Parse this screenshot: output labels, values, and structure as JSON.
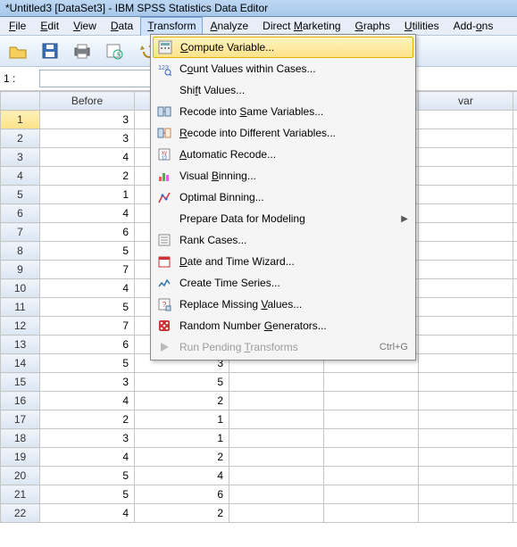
{
  "title": "*Untitled3 [DataSet3] - IBM SPSS Statistics Data Editor",
  "menubar": [
    {
      "label": "File",
      "ul": "F"
    },
    {
      "label": "Edit",
      "ul": "E"
    },
    {
      "label": "View",
      "ul": "V"
    },
    {
      "label": "Data",
      "ul": "D"
    },
    {
      "label": "Transform",
      "ul": "T",
      "open": true
    },
    {
      "label": "Analyze",
      "ul": "A"
    },
    {
      "label": "Direct Marketing",
      "ul": "M"
    },
    {
      "label": "Graphs",
      "ul": "G"
    },
    {
      "label": "Utilities",
      "ul": "U"
    },
    {
      "label": "Add-ons",
      "ul": "o"
    }
  ],
  "transform_menu": [
    {
      "label": "Compute Variable...",
      "ul": "C",
      "icon": "compute",
      "highlight": true
    },
    {
      "label": "Count Values within Cases...",
      "ul": "o",
      "icon": "count"
    },
    {
      "label": "Shift Values...",
      "ul": "f",
      "icon": ""
    },
    {
      "label": "Recode into Same Variables...",
      "ul": "S",
      "icon": "recode-same"
    },
    {
      "label": "Recode into Different Variables...",
      "ul": "R",
      "icon": "recode-diff"
    },
    {
      "label": "Automatic Recode...",
      "ul": "A",
      "icon": "auto-recode"
    },
    {
      "label": "Visual Binning...",
      "ul": "B",
      "icon": "visual-bin"
    },
    {
      "label": "Optimal Binning...",
      "ul": "I",
      "icon": "optimal-bin"
    },
    {
      "label": "Prepare Data for Modeling",
      "ul": "",
      "icon": "",
      "submenu": true
    },
    {
      "label": "Rank Cases...",
      "ul": "K",
      "icon": "rank"
    },
    {
      "label": "Date and Time Wizard...",
      "ul": "D",
      "icon": "date"
    },
    {
      "label": "Create Time Series...",
      "ul": "M",
      "icon": "timeseries"
    },
    {
      "label": "Replace Missing Values...",
      "ul": "V",
      "icon": "missing"
    },
    {
      "label": "Random Number Generators...",
      "ul": "G",
      "icon": "random"
    },
    {
      "label": "Run Pending Transforms",
      "ul": "T",
      "icon": "run",
      "shortcut": "Ctrl+G",
      "disabled": true
    }
  ],
  "toolbar_icons": [
    "open",
    "save",
    "print",
    "recent",
    "undo",
    "redo",
    "|",
    "find",
    "insert-var",
    "weight-grid"
  ],
  "address": "1 :",
  "formula_value": "",
  "columns": [
    "",
    "Before",
    "",
    "",
    "",
    "var",
    ""
  ],
  "rows": [
    {
      "n": 1,
      "c": [
        "3",
        "",
        "",
        "",
        "",
        ""
      ],
      "selected": true
    },
    {
      "n": 2,
      "c": [
        "3",
        "",
        "",
        "",
        "",
        ""
      ]
    },
    {
      "n": 3,
      "c": [
        "4",
        "",
        "",
        "",
        "",
        ""
      ]
    },
    {
      "n": 4,
      "c": [
        "2",
        "",
        "",
        "",
        "",
        ""
      ]
    },
    {
      "n": 5,
      "c": [
        "1",
        "",
        "",
        "",
        "",
        ""
      ]
    },
    {
      "n": 6,
      "c": [
        "4",
        "",
        "",
        "",
        "",
        ""
      ]
    },
    {
      "n": 7,
      "c": [
        "6",
        "",
        "",
        "",
        "",
        ""
      ]
    },
    {
      "n": 8,
      "c": [
        "5",
        "",
        "",
        "",
        "",
        ""
      ]
    },
    {
      "n": 9,
      "c": [
        "7",
        "",
        "",
        "",
        "",
        ""
      ]
    },
    {
      "n": 10,
      "c": [
        "4",
        "",
        "",
        "",
        "",
        ""
      ]
    },
    {
      "n": 11,
      "c": [
        "5",
        "",
        "",
        "",
        "",
        ""
      ]
    },
    {
      "n": 12,
      "c": [
        "7",
        "",
        "",
        "",
        "",
        ""
      ]
    },
    {
      "n": 13,
      "c": [
        "6",
        "",
        "",
        "",
        "",
        ""
      ]
    },
    {
      "n": 14,
      "c": [
        "5",
        "3",
        "",
        "",
        "",
        ""
      ]
    },
    {
      "n": 15,
      "c": [
        "3",
        "5",
        "",
        "",
        "",
        ""
      ]
    },
    {
      "n": 16,
      "c": [
        "4",
        "2",
        "",
        "",
        "",
        ""
      ]
    },
    {
      "n": 17,
      "c": [
        "2",
        "1",
        "",
        "",
        "",
        ""
      ]
    },
    {
      "n": 18,
      "c": [
        "3",
        "1",
        "",
        "",
        "",
        ""
      ]
    },
    {
      "n": 19,
      "c": [
        "4",
        "2",
        "",
        "",
        "",
        ""
      ]
    },
    {
      "n": 20,
      "c": [
        "5",
        "4",
        "",
        "",
        "",
        ""
      ]
    },
    {
      "n": 21,
      "c": [
        "5",
        "6",
        "",
        "",
        "",
        ""
      ]
    },
    {
      "n": 22,
      "c": [
        "4",
        "2",
        "",
        "",
        "",
        ""
      ]
    }
  ]
}
